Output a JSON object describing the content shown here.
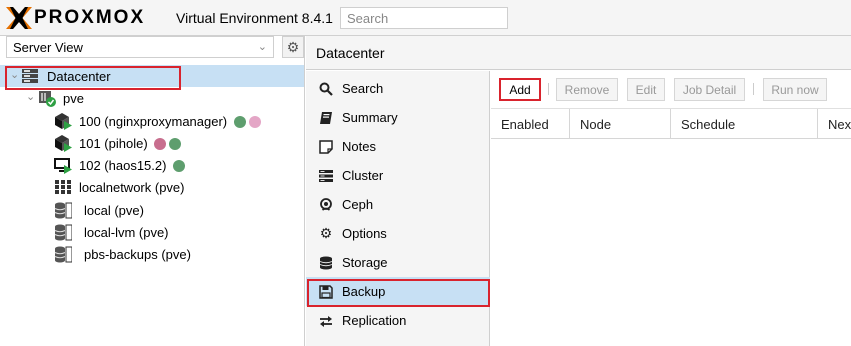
{
  "header": {
    "logo_text": "PROXMOX",
    "version": "Virtual Environment 8.4.1",
    "search_placeholder": "Search"
  },
  "left_panel": {
    "view_select": "Server View",
    "tree": [
      {
        "label": "Datacenter",
        "icon": "datacenter-icon",
        "selected": true
      },
      {
        "label": "pve",
        "icon": "node-icon"
      },
      {
        "label": "100 (nginxproxymanager)",
        "icon": "ct-running-icon",
        "tags": [
          "#5e9e6e",
          "#e4a6c6"
        ]
      },
      {
        "label": "101 (pihole)",
        "icon": "ct-running-icon",
        "tags": [
          "#c86e8e",
          "#5e9e6e"
        ]
      },
      {
        "label": "102 (haos15.2)",
        "icon": "vm-running-icon",
        "tags": [
          "#5e9e6e"
        ]
      },
      {
        "label": "localnetwork (pve)",
        "icon": "sdn-icon"
      },
      {
        "label": "local (pve)",
        "icon": "storage-icon"
      },
      {
        "label": "local-lvm (pve)",
        "icon": "storage-icon"
      },
      {
        "label": "pbs-backups (pve)",
        "icon": "storage-icon"
      }
    ]
  },
  "right_panel": {
    "title": "Datacenter",
    "nav": [
      {
        "label": "Search",
        "icon": "search-icon"
      },
      {
        "label": "Summary",
        "icon": "book-icon"
      },
      {
        "label": "Notes",
        "icon": "notes-icon"
      },
      {
        "label": "Cluster",
        "icon": "server-icon"
      },
      {
        "label": "Ceph",
        "icon": "ceph-icon"
      },
      {
        "label": "Options",
        "icon": "gear-icon"
      },
      {
        "label": "Storage",
        "icon": "database-icon"
      },
      {
        "label": "Backup",
        "icon": "floppy-icon",
        "active": true
      },
      {
        "label": "Replication",
        "icon": "replication-icon"
      }
    ],
    "toolbar": {
      "add": "Add",
      "remove": "Remove",
      "edit": "Edit",
      "job_detail": "Job Detail",
      "run_now": "Run now"
    },
    "columns": [
      "Enabled",
      "Node",
      "Schedule",
      "Nex"
    ]
  },
  "colors": {
    "highlight_red": "#d9232d",
    "selected_bg": "#c7e0f4",
    "running_green": "#2ea043"
  }
}
